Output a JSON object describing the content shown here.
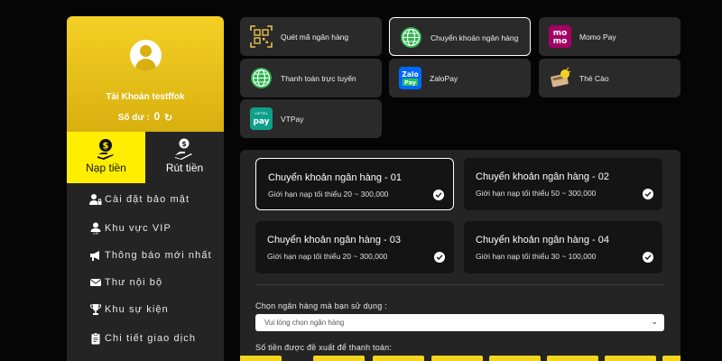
{
  "profile": {
    "account_label": "Tài Khoản testffok",
    "balance_label": "Số dư :",
    "balance_value": "0"
  },
  "tabs": {
    "deposit": "Nạp tiền",
    "withdraw": "Rút tiền"
  },
  "menu": [
    {
      "label": "Cài đặt bảo mật",
      "icon": "user-lock-icon"
    },
    {
      "label": "Khu vực VIP",
      "icon": "vip-user-icon"
    },
    {
      "label": "Thông báo mới nhất",
      "icon": "megaphone-icon"
    },
    {
      "label": "Thư nội bộ",
      "icon": "envelope-icon"
    },
    {
      "label": "Khu sự kiện",
      "icon": "trophy-icon"
    },
    {
      "label": "Chi tiết giao dịch",
      "icon": "clipboard-icon"
    }
  ],
  "methods": [
    {
      "label": "Quét mã ngân hàng",
      "icon": "qr-code-icon",
      "active": false
    },
    {
      "label": "Chuyển khoản ngân hàng",
      "icon": "globe-icon",
      "active": true
    },
    {
      "label": "Momo Pay",
      "icon": "momo-icon",
      "active": false
    },
    {
      "label": "Thanh toán trực tuyến",
      "icon": "globe-icon",
      "active": false
    },
    {
      "label": "ZaloPay",
      "icon": "zalopay-icon",
      "active": false
    },
    {
      "label": "Thẻ Cào",
      "icon": "scratch-card-icon",
      "active": false
    },
    {
      "label": "VTPay",
      "icon": "vtpay-icon",
      "active": false
    }
  ],
  "method_icon_text": {
    "momo_top": "mo",
    "momo_bottom": "mo",
    "zalo_top": "Zalo",
    "zalo_bottom": "Pay",
    "vtpay_top": "VIETTEL",
    "vtpay_bottom": "pay"
  },
  "banks": [
    {
      "title": "Chuyển khoản ngân hàng - 01",
      "limit": "Giới hạn nạp tối thiểu 20 ~ 300,000",
      "selected": true
    },
    {
      "title": "Chuyển khoản ngân hàng - 02",
      "limit": "Giới hạn nạp tối thiểu 50 ~ 300,000",
      "selected": false
    },
    {
      "title": "Chuyển khoản ngân hàng - 03",
      "limit": "Giới hạn nạp tối thiểu 20 ~ 300,000",
      "selected": false
    },
    {
      "title": "Chuyển khoản ngân hàng - 04",
      "limit": "Giới hạn nạp tối thiểu 30 ~ 100,000",
      "selected": false
    }
  ],
  "form": {
    "bank_select_label": "Chọn ngân hàng mà bạn sử dụng :",
    "bank_select_placeholder": "Vui lòng chọn ngân hàng",
    "amount_label": "Số tiền được đề xuất để thanh toán:"
  },
  "colors": {
    "accent_yellow": "#ffee00",
    "profile_gold": "#d8b00f",
    "panel_bg": "#242424",
    "page_bg": "#050505",
    "momo": "#a50064",
    "zalopay": "#0068ff",
    "vtpay": "#0e9f8a",
    "globe_green": "#2bb24c"
  }
}
